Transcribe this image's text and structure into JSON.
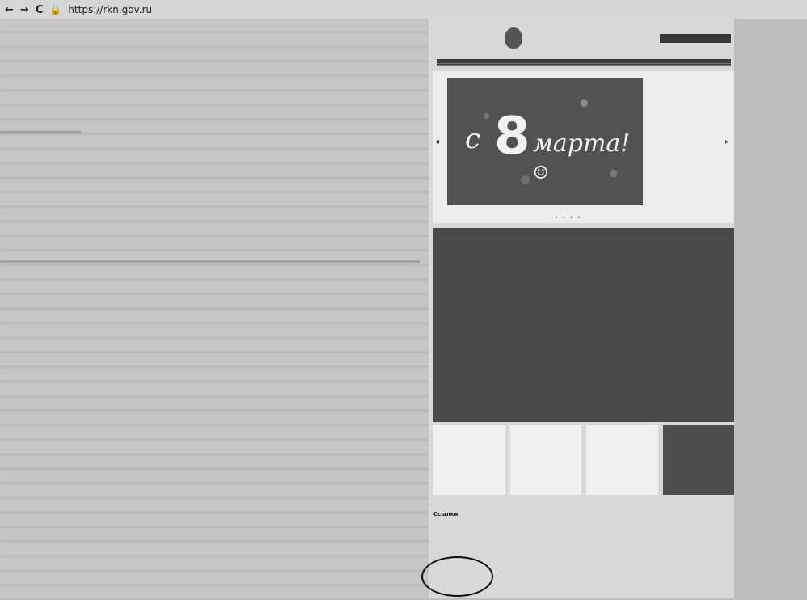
{
  "browser": {
    "back_glyph": "←",
    "forward_glyph": "→",
    "reload_glyph": "C",
    "lock_glyph": "🔒",
    "url": "https://rkn.gov.ru"
  },
  "header": {
    "org_name": "",
    "lang": "",
    "action_button": ""
  },
  "nav": {
    "home": ""
  },
  "slider": {
    "prev_glyph": "◂",
    "next_glyph": "▸",
    "slide_c": "с",
    "slide_num": "8",
    "slide_word": "марта!",
    "slide_sub": "☺",
    "side_text": "",
    "dots": "• • • •"
  },
  "news": {
    "title": "",
    "items": [
      "",
      "",
      "",
      "",
      "",
      "",
      "",
      "",
      "",
      "",
      "",
      ""
    ]
  },
  "cards": [
    "",
    "",
    ""
  ],
  "links": {
    "title": "Ссылки",
    "items": [
      "",
      "",
      "",
      "",
      "",
      "",
      "",
      "",
      "",
      ""
    ]
  },
  "colors": {
    "background": "#bdbdbd",
    "site_panel": "#d8d8d8",
    "news_dark": "#4a4a4a",
    "annotation": "#111111"
  }
}
